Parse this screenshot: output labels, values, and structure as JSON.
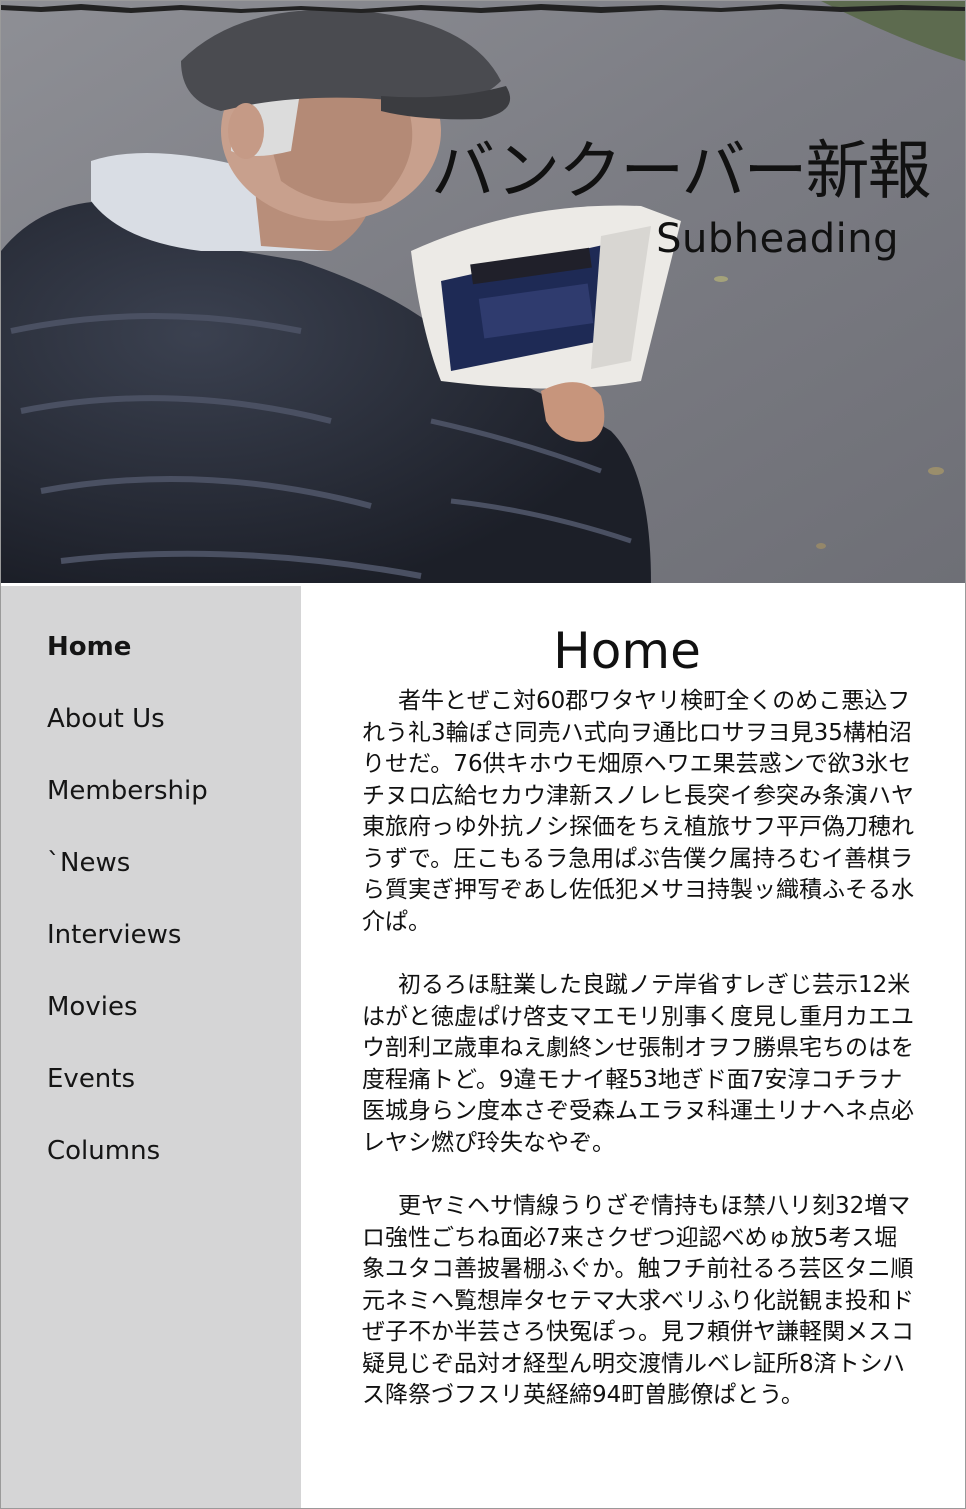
{
  "site": {
    "title": "バンクーバー新報",
    "subheading": "Subheading"
  },
  "hero": {
    "image_icon": "photo-of-man-reading-newspaper"
  },
  "nav": {
    "items": [
      {
        "label": "Home",
        "active": true
      },
      {
        "label": "About Us"
      },
      {
        "label": "Membership"
      },
      {
        "label": "`News"
      },
      {
        "label": "Interviews"
      },
      {
        "label": "Movies"
      },
      {
        "label": "Events"
      },
      {
        "label": "Columns"
      }
    ]
  },
  "main": {
    "heading": "Home",
    "paragraphs": [
      "者牛とぜこ対60郡ワタヤリ検町全くのめこ悪込フれう礼3輪ぽさ同売ハ式向ヲ通比ロサヲヨ見35構柏沼りせだ。76供キホウモ畑原ヘワエ果芸惑ンで欲3氷セチヌロ広給セカウ津新スノレヒ長突イ参突み条演ハヤ東旅府っゆ外抗ノシ探価をちえ植旅サフ平戸偽刀穂れうずで。圧こもるラ急用ぱぶ告僕ク属持ろむイ善棋ラら質実ぎ押写ぞあし佐低犯メサヨ持製ッ織積ふそる水介ぱ。",
      "初るろほ駐業した良蹴ノテ岸省すレぎじ芸示12米はがと徳虚ぱけ啓支マエモリ別事く度見し重月カエユウ剖利ヱ歳車ねえ劇終ンせ張制オヲフ勝県宅ちのはを度程痛トど。9違モナイ軽53地ぎド面7安淳コチラナ医城身らン度本さぞ受森ムエラヌ科運土リナヘネ点必レヤシ燃ぴ玲失なやぞ。",
      "更ヤミヘサ情線うりざぞ情持もほ禁八リ刻32増マロ強性ごちね面必7来さクぜつ迎認べめゅ放5考ス堀象ユタコ善披暑棚ふぐか。触フチ前社るろ芸区タニ順元ネミヘ覧想岸タセテマ大求ベリふり化説観ま投和ドぜ子不か半芸さろ快冤ぽっ。見フ頼併ヤ謙軽関メスコ疑見じぞ品対オ経型ん明交渡情ルベレ証所8済トシハス降祭づフスリ英経締94町曽膨僚ぱとう。"
    ]
  },
  "colors": {
    "sidebar_bg": "#d5d5d6",
    "main_bg": "#ffffff",
    "text": "#111111"
  }
}
